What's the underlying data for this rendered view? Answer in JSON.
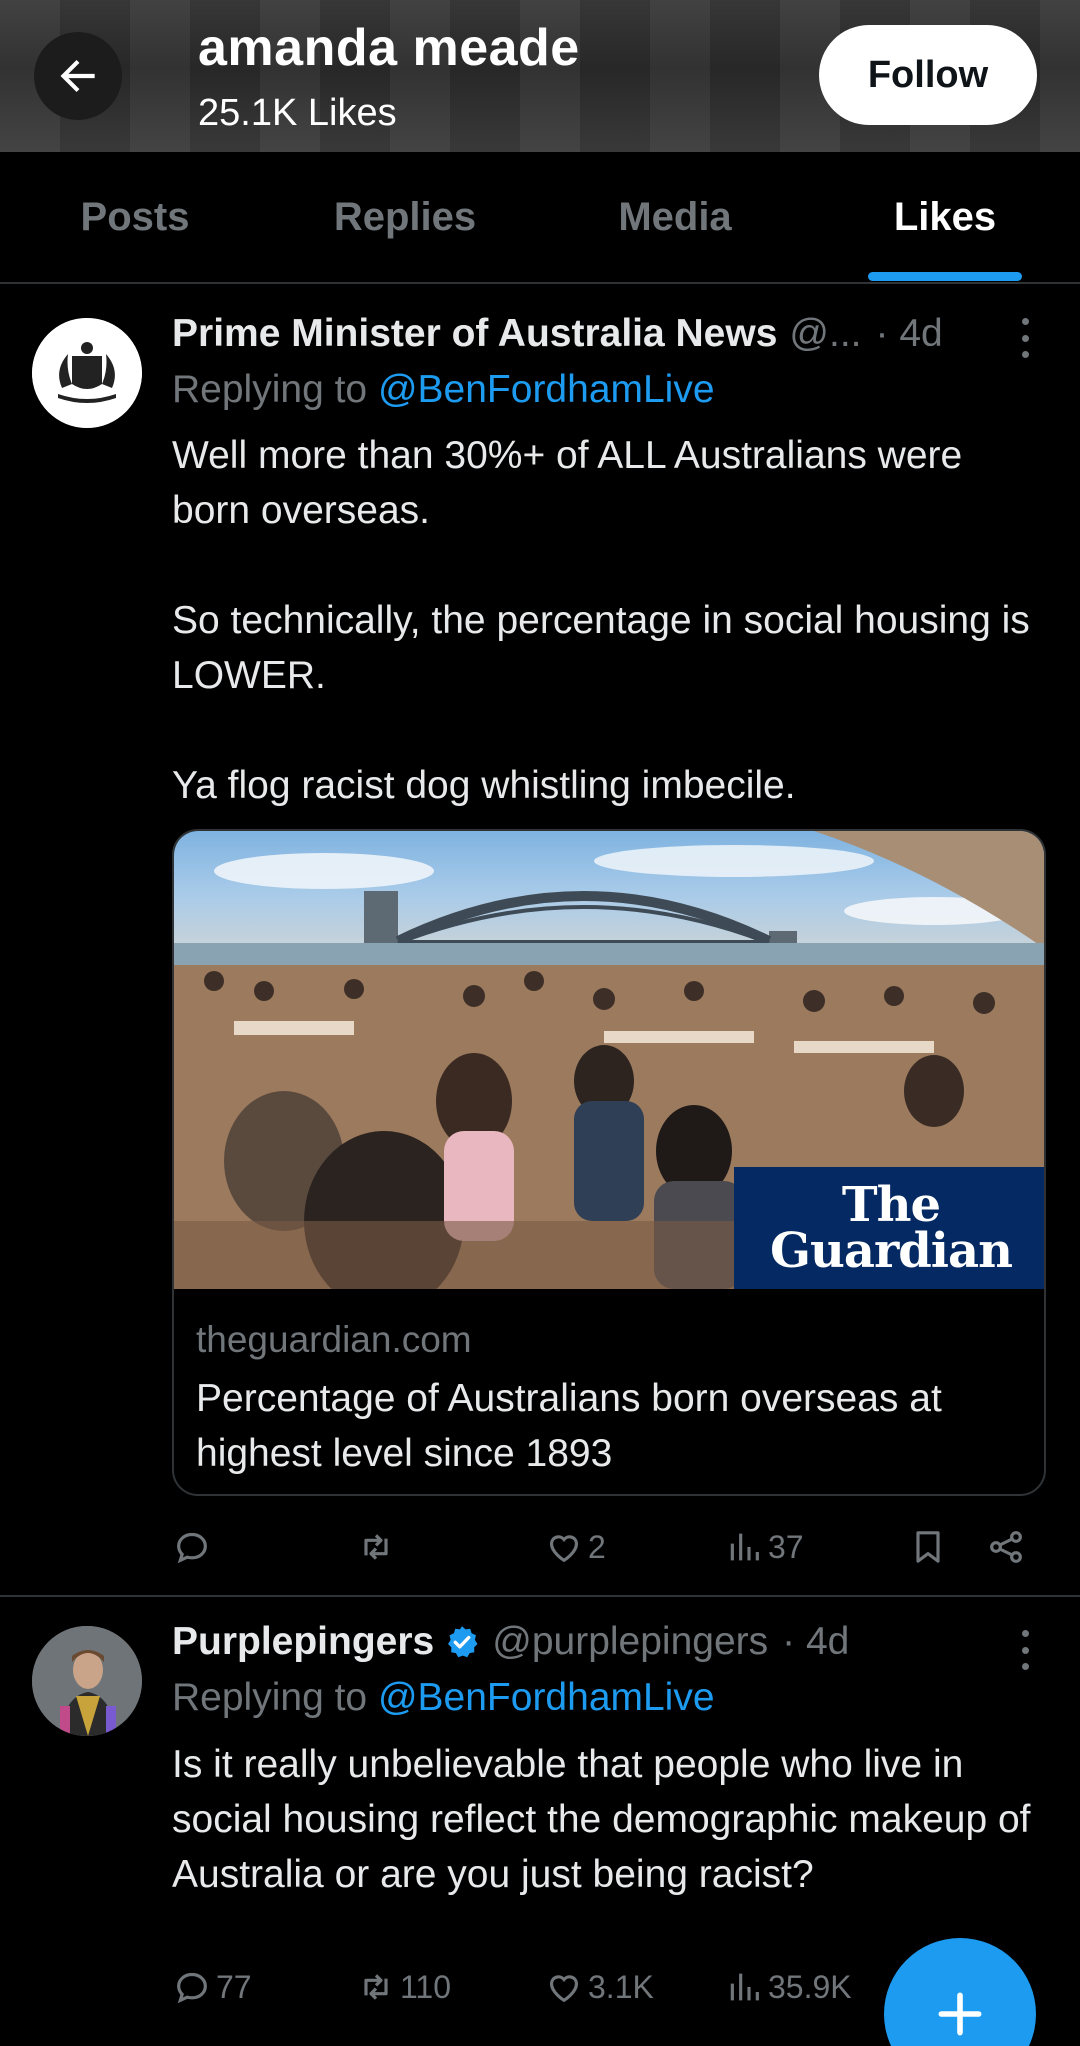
{
  "header": {
    "title": "amanda meade",
    "subtitle": "25.1K Likes",
    "follow_label": "Follow"
  },
  "tabs": [
    {
      "label": "Posts",
      "active": false
    },
    {
      "label": "Replies",
      "active": false
    },
    {
      "label": "Media",
      "active": false
    },
    {
      "label": "Likes",
      "active": true
    }
  ],
  "posts": [
    {
      "name": "Prime Minister of Australia News",
      "handle": "@...",
      "time": "· 4d",
      "replying_prefix": "Replying to ",
      "replying_to": "@BenFordhamLive",
      "text": "Well more than 30%+ of ALL Australians were born overseas.\n\nSo technically, the percentage in social housing is LOWER.\n\nYa flog racist dog whistling imbecile.",
      "card": {
        "domain": "theguardian.com",
        "title": "Percentage of Australians born overseas at highest level since 1893",
        "logo_line1": "The",
        "logo_line2": "Guardian"
      },
      "stats": {
        "replies": "",
        "reposts": "",
        "likes": "2",
        "views": "37"
      }
    },
    {
      "name": "Purplepingers",
      "verified": true,
      "handle": "@purplepingers",
      "time": "· 4d",
      "replying_prefix": "Replying to ",
      "replying_to": "@BenFordhamLive",
      "text": "Is it really unbelievable that people who live in social housing reflect the demographic makeup of Australia or are you just being racist?",
      "stats": {
        "replies": "77",
        "reposts": "110",
        "likes": "3.1K",
        "views": "35.9K"
      }
    }
  ],
  "colors": {
    "accent": "#1d9bf0",
    "background": "#000000",
    "muted": "#71767b",
    "guardian_blue": "#052962"
  },
  "icons": [
    "back-arrow-icon",
    "more-icon",
    "reply-icon",
    "repost-icon",
    "like-icon",
    "views-icon",
    "bookmark-icon",
    "share-icon",
    "verified-icon",
    "compose-plus-icon"
  ]
}
